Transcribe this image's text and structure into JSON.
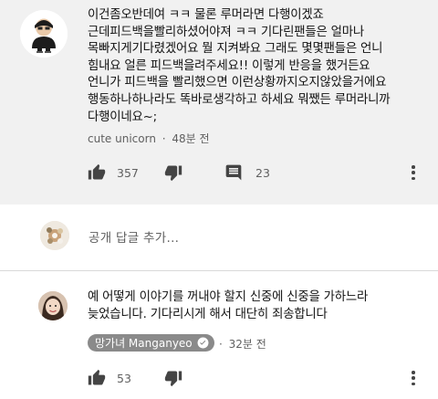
{
  "main_comment": {
    "text": "이건좀오반데여 ㅋㅋ 물론 루머라면 다행이겠죠\n근데피드백을빨리하셨어야져 ㅋㅋ 기다린팬들은 얼마나\n목빠지게기다렸겠어요 뭘 지켜봐요 그래도 몇몇팬들은 언니\n힘내요 얼른 피드백을려주세요!! 이렇게 반응을 했거든요\n언니가 피드백을 빨리했으면 이런상황까지오지않았을거에요\n행동하나하나라도 똑바로생각하고 하세요 뭐쨌든 루머라니까\n다행이네요~;",
    "author": "cute unicorn",
    "separator": "·",
    "time": "48분 전",
    "likes": "357",
    "replies": "23",
    "icons": [
      "thumbs-up-icon",
      "thumbs-down-icon",
      "comment-icon",
      "more-vert-icon"
    ]
  },
  "reply_box": {
    "placeholder": "공개 답글 추가..."
  },
  "reply": {
    "text": "예 어떻게 이야기를 꺼내야 할지 신중에 신중을 가하느라\n늦었습니다. 기다리시게 해서 대단히 죄송합니다",
    "author": "망가녀 Manganyeo",
    "separator": "·",
    "time": "32분 전",
    "likes": "53",
    "author_chip_color": "#8a8a8a"
  }
}
